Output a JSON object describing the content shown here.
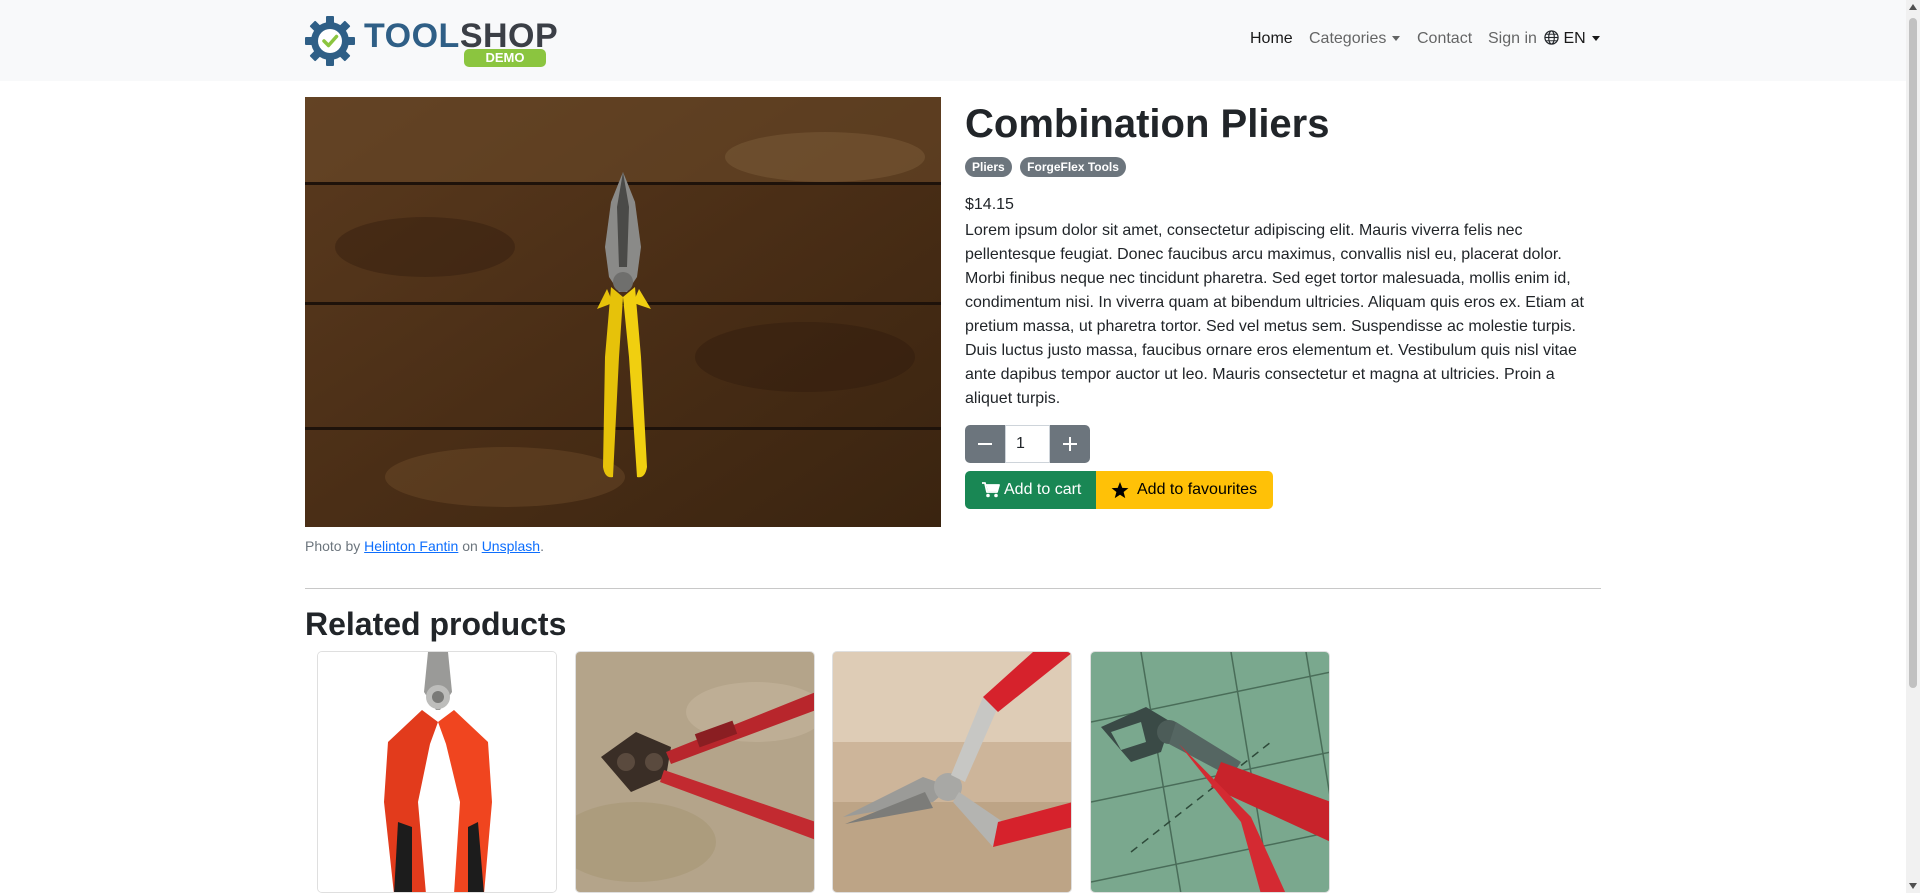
{
  "header": {
    "logo_text_part1": "TOOL",
    "logo_text_part2": "SHOP",
    "logo_badge": "DEMO",
    "nav": {
      "home": "Home",
      "categories": "Categories",
      "contact": "Contact",
      "signin": "Sign in",
      "language": "EN"
    }
  },
  "product": {
    "title": "Combination Pliers",
    "tags": [
      "Pliers",
      "ForgeFlex Tools"
    ],
    "price": "$14.15",
    "description": "Lorem ipsum dolor sit amet, consectetur adipiscing elit. Mauris viverra felis nec pellentesque feugiat. Donec faucibus arcu maximus, convallis nisl eu, placerat dolor. Morbi finibus neque nec tincidunt pharetra. Sed eget tortor malesuada, mollis enim id, condimentum nisi. In viverra quam at bibendum ultricies. Aliquam quis eros ex. Etiam at pretium massa, ut pharetra tortor. Sed vel metus sem. Suspendisse ac molestie turpis. Duis luctus justo massa, faucibus ornare eros elementum et. Vestibulum quis nisl vitae ante dapibus tempor auctor ut leo. Mauris consectetur et magna at ultricies. Proin a aliquet turpis.",
    "quantity": "1",
    "add_to_cart": "Add to cart",
    "add_to_favourites": "Add to favourites",
    "credit": {
      "prefix": "Photo by",
      "author": "Helinton Fantin",
      "middle": "on",
      "site": "Unsplash",
      "suffix": "."
    }
  },
  "related": {
    "title": "Related products"
  },
  "colors": {
    "navbar_bg": "#f8f9fa",
    "success": "#198754",
    "warning": "#ffc107",
    "secondary": "#6c757d",
    "brand_blue": "#2f5f86",
    "brand_green": "#8bc53f"
  }
}
